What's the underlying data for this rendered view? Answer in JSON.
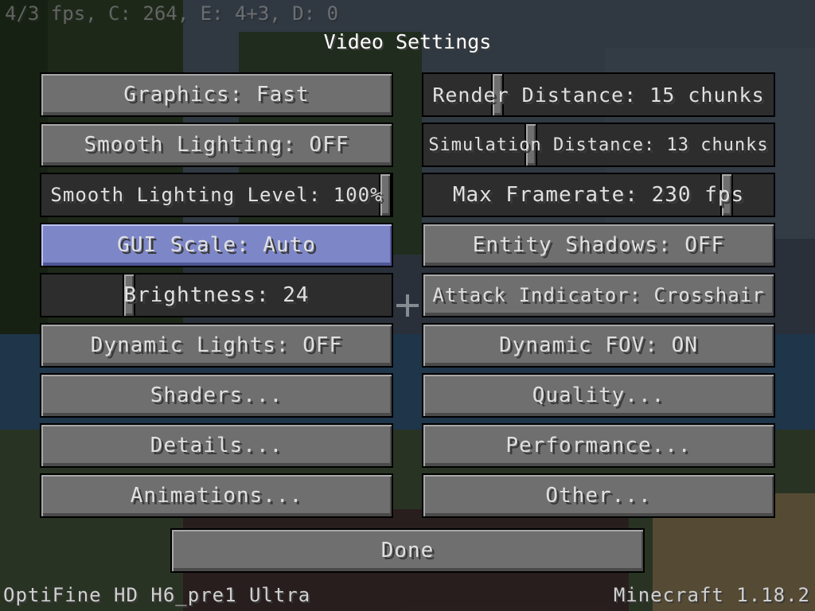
{
  "debug_overlay": "4/3 fps, C: 264, E: 4+3, D: 0",
  "title": "Video Settings",
  "colors": {
    "button_face": "#6f6f6f",
    "button_hover": "#7d87c8",
    "slider_track": "#2d2d2d",
    "text": "#e0e0e0"
  },
  "left_column": [
    {
      "label": "Graphics: Fast",
      "kind": "button"
    },
    {
      "label": "Smooth Lighting: OFF",
      "kind": "button"
    },
    {
      "label": "Smooth Lighting Level: 100%",
      "kind": "slider",
      "value_fraction": 1.0
    },
    {
      "label": "GUI Scale: Auto",
      "kind": "button",
      "state": "hover"
    },
    {
      "label": "Brightness: 24",
      "kind": "slider",
      "value_fraction": 0.24
    },
    {
      "label": "Dynamic Lights: OFF",
      "kind": "button"
    },
    {
      "label": "Shaders...",
      "kind": "button"
    },
    {
      "label": "Details...",
      "kind": "button"
    },
    {
      "label": "Animations...",
      "kind": "button"
    }
  ],
  "right_column": [
    {
      "label": "Render Distance: 15 chunks",
      "kind": "slider",
      "value_fraction": 0.2
    },
    {
      "label": "Simulation Distance: 13 chunks",
      "kind": "slider",
      "value_fraction": 0.3
    },
    {
      "label": "Max Framerate: 230 fps",
      "kind": "slider",
      "value_fraction": 0.88
    },
    {
      "label": "Entity Shadows: OFF",
      "kind": "button"
    },
    {
      "label": "Attack Indicator: Crosshair",
      "kind": "button"
    },
    {
      "label": "Dynamic FOV: ON",
      "kind": "button"
    },
    {
      "label": "Quality...",
      "kind": "button"
    },
    {
      "label": "Performance...",
      "kind": "button"
    },
    {
      "label": "Other...",
      "kind": "button"
    }
  ],
  "done_label": "Done",
  "footer": {
    "left": "OptiFine HD H6_pre1 Ultra",
    "right": "Minecraft 1.18.2"
  }
}
